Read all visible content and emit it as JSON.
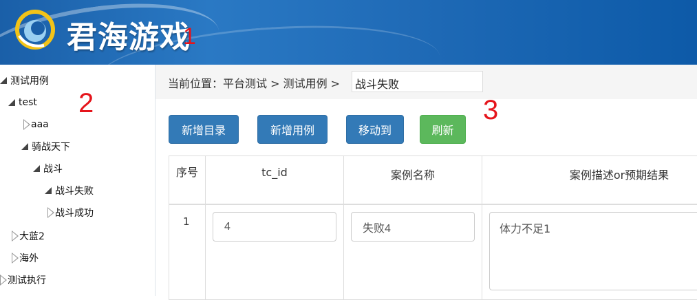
{
  "header": {
    "brand": "君海游戏",
    "colors": {
      "banner": "#1f6ab6",
      "annotation": "#e5141b"
    }
  },
  "annotations": {
    "one": "1",
    "two": "2",
    "three": "3"
  },
  "sidebar": {
    "tree": [
      {
        "label": "测试用例",
        "state": "open"
      },
      {
        "label": "test",
        "state": "open"
      },
      {
        "label": "aaa",
        "state": "closed"
      },
      {
        "label": "骑战天下",
        "state": "open"
      },
      {
        "label": "战斗",
        "state": "open"
      },
      {
        "label": "战斗失败",
        "state": "open"
      },
      {
        "label": "战斗成功",
        "state": "closed"
      },
      {
        "label": "大蓝2",
        "state": "closed"
      },
      {
        "label": "海外",
        "state": "closed"
      },
      {
        "label": "测试执行",
        "state": "closed"
      }
    ]
  },
  "breadcrumb": {
    "label": "当前位置：平台测试 > 测试用例 >",
    "current": "战斗失败"
  },
  "toolbar": {
    "new_dir": "新增目录",
    "new_case": "新增用例",
    "move_to": "移动到",
    "refresh": "刷新"
  },
  "table": {
    "headers": {
      "seq": "序号",
      "tc_id": "tc_id",
      "name": "案例名称",
      "desc": "案例描述or预期结果"
    },
    "rows": [
      {
        "seq": "1",
        "tc_id": "4",
        "name": "失败4",
        "desc": "体力不足1"
      }
    ]
  }
}
